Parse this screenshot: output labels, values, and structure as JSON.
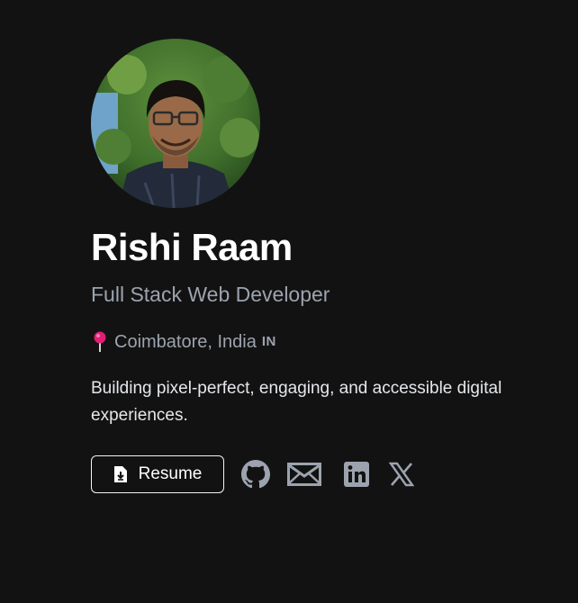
{
  "profile": {
    "name": "Rishi Raam",
    "role": "Full Stack Web Developer",
    "location": "Coimbatore, India",
    "country_code": "IN",
    "bio": "Building pixel-perfect, engaging, and accessible digital experiences."
  },
  "actions": {
    "resume_label": "Resume"
  },
  "social": [
    "github-icon",
    "mail-icon",
    "linkedin-icon",
    "x-icon"
  ],
  "colors": {
    "background": "#121212",
    "text_primary": "#ffffff",
    "text_muted": "#9ca3af",
    "pin": "#e11d74",
    "icon": "#9ca3af"
  }
}
